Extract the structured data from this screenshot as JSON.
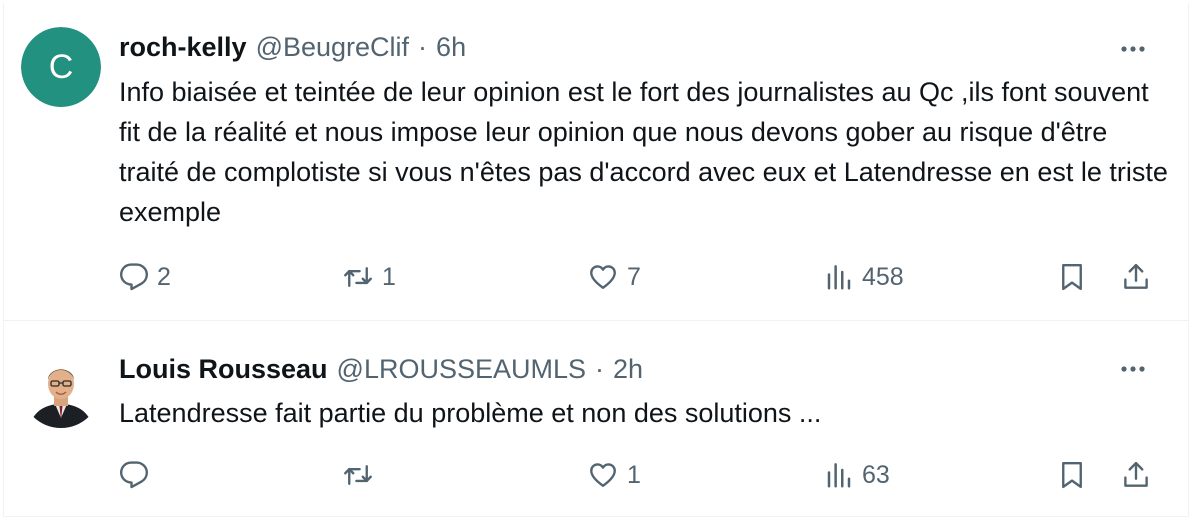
{
  "colors": {
    "accent_avatar": "#23917f",
    "secondary_text": "#536471",
    "text": "#0f1419",
    "divider": "#eff3f4"
  },
  "tweets": [
    {
      "avatar": {
        "letter": "C",
        "bg": "#23917f"
      },
      "name": "roch-kelly",
      "handle": "@BeugreClif",
      "sep": "·",
      "time": "6h",
      "text": "Info biaisée et teintée de leur opinion est le fort des journalistes au Qc ,ils font souvent fit de la réalité et nous impose leur opinion que nous devons gober au risque d'être traité de complotiste si vous n'êtes pas d'accord avec eux et Latendresse en est le triste exemple",
      "replies": "2",
      "retweets": "1",
      "likes": "7",
      "views": "458",
      "icons": [
        "more-icon",
        "reply-icon",
        "retweet-icon",
        "like-icon",
        "views-icon",
        "bookmark-icon",
        "share-icon"
      ]
    },
    {
      "avatar": {
        "photo": "profile-photo"
      },
      "name": "Louis Rousseau",
      "handle": "@LROUSSEAUMLS",
      "sep": "·",
      "time": "2h",
      "text": "Latendresse fait partie du problème et non des solutions ...",
      "replies": "",
      "retweets": "",
      "likes": "1",
      "views": "63",
      "icons": [
        "more-icon",
        "reply-icon",
        "retweet-icon",
        "like-icon",
        "views-icon",
        "bookmark-icon",
        "share-icon"
      ]
    }
  ]
}
